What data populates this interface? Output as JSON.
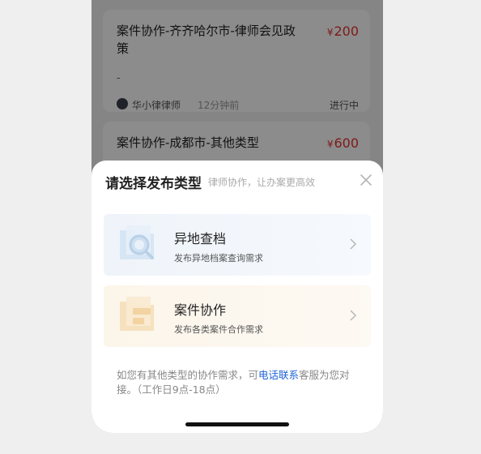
{
  "cards": [
    {
      "title": "案件协作-齐齐哈尔市-律师会见政策",
      "currency": "¥",
      "price": "200",
      "description": "-",
      "author": "华小律律师",
      "time": "12分钟前",
      "status": "进行中"
    },
    {
      "title": "案件协作-成都市-其他类型",
      "currency": "¥",
      "price": "600"
    }
  ],
  "sheet": {
    "title": "请选择发布类型",
    "subtitle": "律师协作，让办案更高效",
    "close_icon": "close-icon",
    "options": [
      {
        "title": "异地查档",
        "desc": "发布异地档案查询需求",
        "icon": "archive-search-icon"
      },
      {
        "title": "案件协作",
        "desc": "发布各类案件合作需求",
        "icon": "case-collab-icon"
      }
    ],
    "note_prefix": "如您有其他类型的协作需求，可",
    "note_link": "电话联系",
    "note_suffix": "客服为您对接。（工作日9点-18点）"
  },
  "colors": {
    "price": "#e8312f",
    "link": "#1f63d8",
    "overlay": "rgba(0,0,0,0.45)"
  }
}
